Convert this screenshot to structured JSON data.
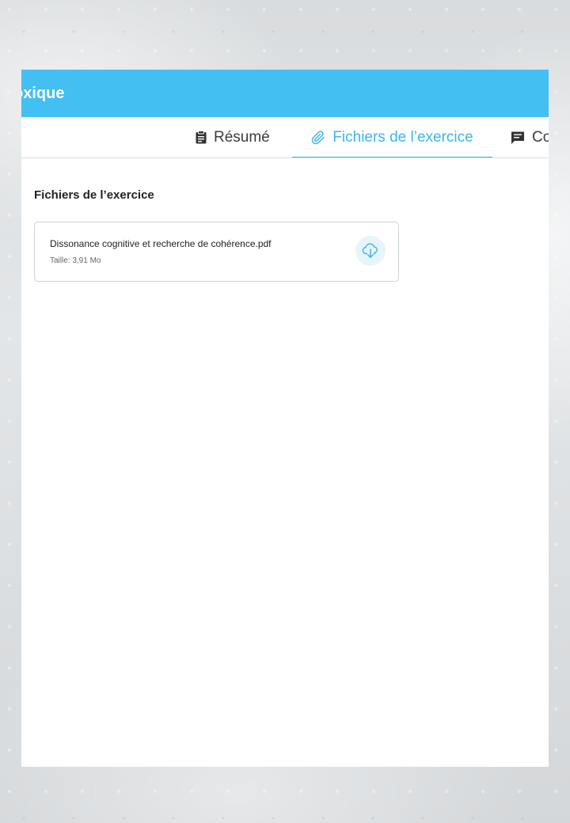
{
  "modal": {
    "title": "oxique"
  },
  "tabs": [
    {
      "label": "Résumé",
      "icon": "clipboard-icon",
      "active": false
    },
    {
      "label": "Fichiers de l’exercice",
      "icon": "paperclip-icon",
      "active": true
    },
    {
      "label": "Co",
      "icon": "comment-icon",
      "active": false
    }
  ],
  "files_section": {
    "title": "Fichiers de l’exercice",
    "files": [
      {
        "name": "Dissonance cognitive et recherche de cohérence.pdf",
        "size": "Taille: 3,91 Mo",
        "action_icon": "cloud-download-icon"
      }
    ]
  },
  "colors": {
    "header": "#44bff2",
    "accent": "#3db6ea",
    "text": "#222222",
    "muted": "#666666",
    "border": "#cfd2d4"
  }
}
